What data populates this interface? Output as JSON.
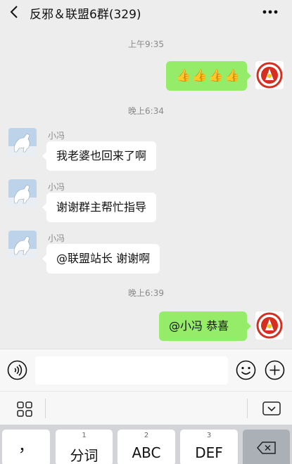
{
  "header": {
    "title": "反邪＆联盟6群(329)",
    "back_icon": "chevron-left-icon",
    "more_icon": "more-dots-icon"
  },
  "messages": [
    {
      "type": "time",
      "text": "上午9:35"
    },
    {
      "type": "outgoing",
      "text": "👍👍👍👍",
      "avatar": "group-logo-avatar"
    },
    {
      "type": "time",
      "text": "晚上6:34"
    },
    {
      "type": "incoming",
      "sender": "小冯",
      "text": "我老婆也回来了啊",
      "avatar": "horse-avatar"
    },
    {
      "type": "incoming",
      "sender": "小冯",
      "text": "谢谢群主帮忙指导",
      "avatar": "horse-avatar"
    },
    {
      "type": "incoming",
      "sender": "小冯",
      "text": "@联盟站长  谢谢啊",
      "avatar": "horse-avatar"
    },
    {
      "type": "time",
      "text": "晚上6:39"
    },
    {
      "type": "outgoing",
      "text": "@小冯 恭喜",
      "avatar": "group-logo-avatar"
    }
  ],
  "input_bar": {
    "value": "",
    "placeholder": ""
  },
  "keyboard": {
    "keys": [
      {
        "num": "",
        "label": "，"
      },
      {
        "num": "1",
        "label": "分词"
      },
      {
        "num": "2",
        "label": "ABC"
      },
      {
        "num": "3",
        "label": "DEF"
      }
    ]
  },
  "colors": {
    "outgoing_bubble": "#95ec69",
    "incoming_bubble": "#ffffff",
    "background": "#ededed"
  }
}
